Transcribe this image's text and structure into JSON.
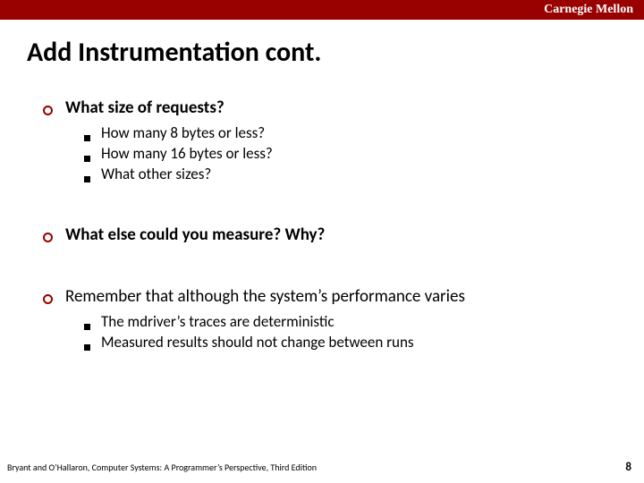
{
  "header": {
    "brand": "Carnegie Mellon"
  },
  "title": "Add Instrumentation cont.",
  "bullets": [
    {
      "text": "What size of requests?",
      "bold": true,
      "sub": [
        "How many 8 bytes or less?",
        "How many 16 bytes or less?",
        "What other sizes?"
      ]
    },
    {
      "text": "What else could you measure?  Why?",
      "bold": true,
      "sub": []
    },
    {
      "text": "Remember that although the system’s performance varies",
      "bold": false,
      "sub": [
        "The mdriver’s traces are deterministic",
        "Measured results should not change between runs"
      ]
    }
  ],
  "footer": {
    "attribution": "Bryant and O’Hallaron, Computer Systems: A Programmer’s Perspective, Third Edition",
    "page": "8"
  }
}
